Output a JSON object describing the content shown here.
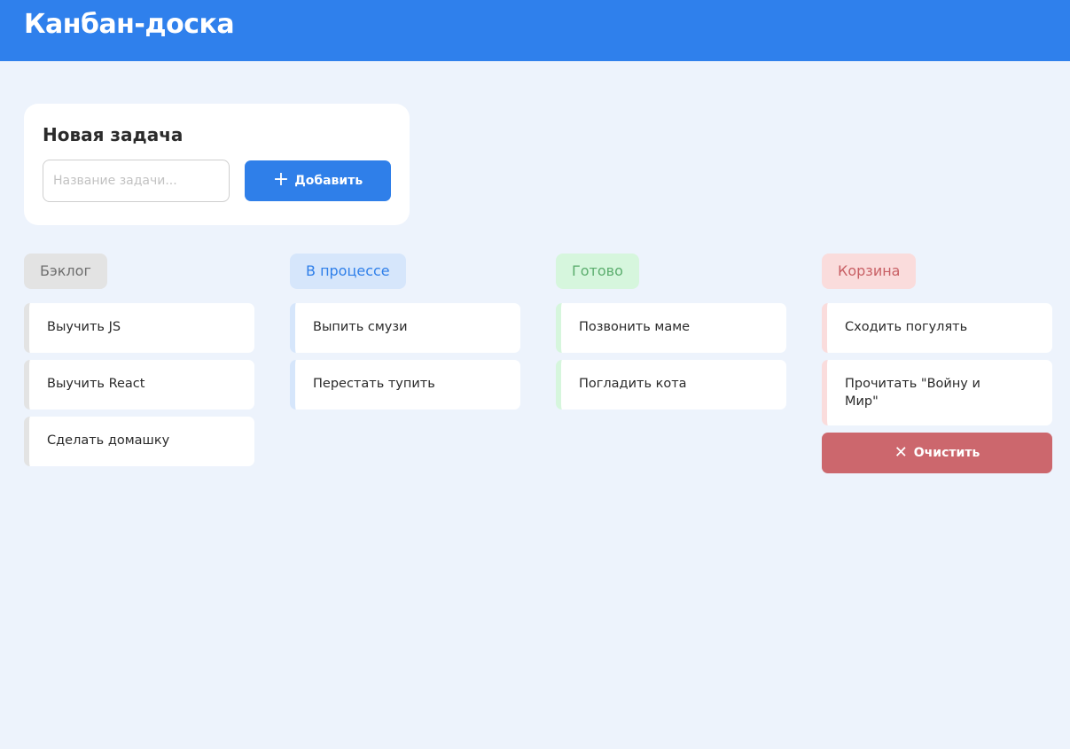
{
  "header": {
    "title": "Канбан-доска"
  },
  "new_task": {
    "title": "Новая задача",
    "input_placeholder": "Название задачи...",
    "input_value": "",
    "add_label": "Добавить",
    "add_icon": "plus-icon"
  },
  "columns": [
    {
      "title": "Бэклог",
      "accent": "#e3e3e3",
      "title_color": "#6e6e6e",
      "cards": [
        "Выучить JS",
        "Выучить React",
        "Сделать домашку"
      ]
    },
    {
      "title": "В процессе",
      "accent": "#d6e6fb",
      "title_color": "#2f7fe9",
      "cards": [
        "Выпить смузи",
        "Перестать тупить"
      ]
    },
    {
      "title": "Готово",
      "accent": "#d6f6dd",
      "title_color": "#5cae6e",
      "cards": [
        "Позвонить маме",
        "Погладить кота"
      ]
    },
    {
      "title": "Корзина",
      "accent": "#fadcdc",
      "title_color": "#c85f64",
      "cards": [
        "Сходить погулять",
        "Прочитать \"Войну и Мир\""
      ]
    }
  ],
  "trash": {
    "clear_label": "Очистить",
    "clear_icon": "close-icon"
  }
}
